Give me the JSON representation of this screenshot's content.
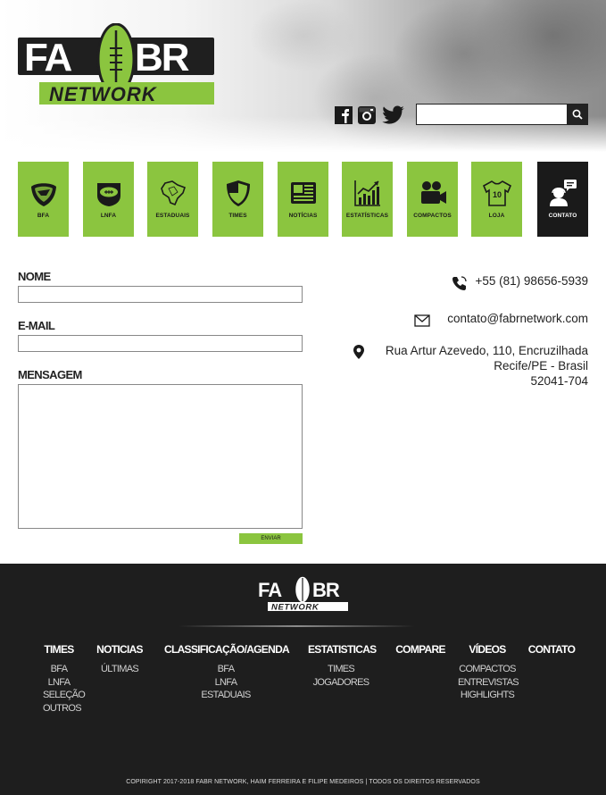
{
  "brand": {
    "logo_top": "FA",
    "logo_top_right": "BR",
    "logo_bottom": "NETWORK"
  },
  "header": {
    "social_icons": [
      "facebook-icon",
      "instagram-icon",
      "twitter-icon"
    ],
    "search": {
      "placeholder": "",
      "value": "",
      "button_icon": "search-icon"
    }
  },
  "nav": {
    "accent": "#8bc53f",
    "active_color": "#1a1a1a",
    "tiles": [
      {
        "label": "BFA",
        "icon": "bfa-logo-icon"
      },
      {
        "label": "LNFA",
        "icon": "football-icon"
      },
      {
        "label": "ESTADUAIS",
        "icon": "brazil-map-icon"
      },
      {
        "label": "TIMES",
        "icon": "shield-icon"
      },
      {
        "label": "NOTÍCIAS",
        "icon": "newspaper-icon"
      },
      {
        "label": "ESTATÍSTICAS",
        "icon": "chart-icon"
      },
      {
        "label": "COMPACTOS",
        "icon": "video-camera-icon"
      },
      {
        "label": "LOJA",
        "icon": "jersey-icon"
      },
      {
        "label": "CONTATO",
        "icon": "contact-icon",
        "active": true
      }
    ]
  },
  "form": {
    "name_label": "NOME",
    "email_label": "E-MAIL",
    "message_label": "MENSAGEM",
    "name_value": "",
    "email_value": "",
    "message_value": "",
    "send_label": "ENVIAR"
  },
  "contact": {
    "phone": "+55 (81) 98656-5939",
    "email": "contato@fabrnetwork.com",
    "address_line1": "Rua Artur Azevedo, 110, Encruzilhada",
    "address_line2": "Recife/PE - Brasil",
    "address_line3": "52041-704"
  },
  "footer": {
    "columns": [
      {
        "head": "TIMES",
        "links": [
          "BFA",
          "LNFA",
          "SELEÇÃO",
          "OUTROS"
        ]
      },
      {
        "head": "NOTICIAS",
        "links": [
          "ÚLTIMAS"
        ]
      },
      {
        "head": "CLASSIFICAÇÃO/AGENDA",
        "links": [
          "BFA",
          "LNFA",
          "ESTADUAIS"
        ]
      },
      {
        "head": "ESTATISTICAS",
        "links": [
          "TIMES",
          "JOGADORES"
        ]
      },
      {
        "head": "COMPARE",
        "links": []
      },
      {
        "head": "VÍDEOS",
        "links": [
          "COMPACTOS",
          "ENTREVISTAS",
          "HIGHLIGHTS"
        ]
      },
      {
        "head": "CONTATO",
        "links": []
      }
    ],
    "copyright": "COPIRIGHT 2017-2018 FABR NETWORK, HAIM FERREIRA E FILIPE MEDEIROS | TODOS OS DIREITOS RESERVADOS"
  }
}
